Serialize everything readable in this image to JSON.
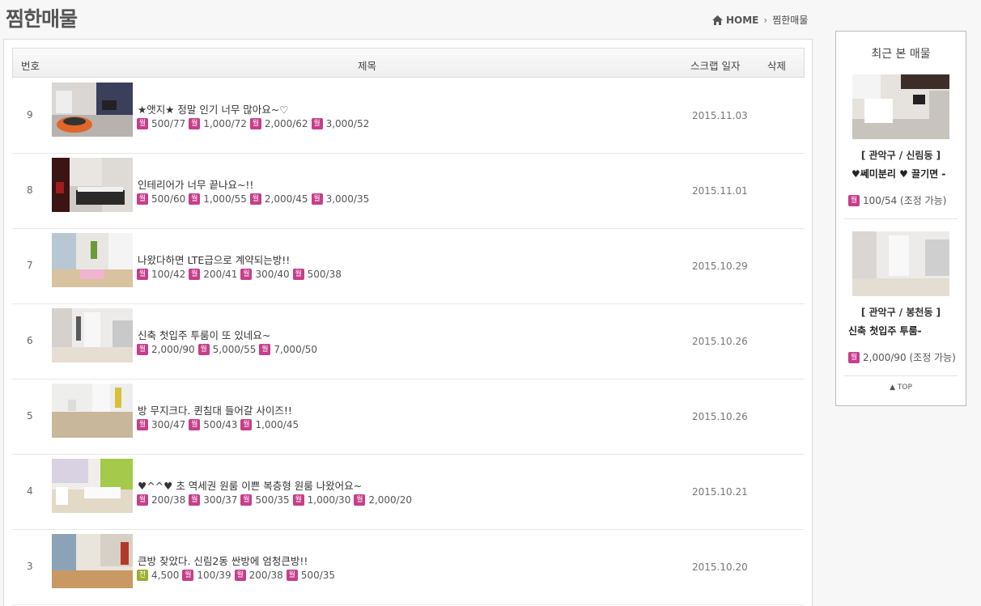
{
  "page": {
    "title": "찜한매물",
    "breadcrumb": {
      "home": "HOME",
      "current": "찜한매물"
    }
  },
  "table": {
    "headers": {
      "num": "번호",
      "title": "제목",
      "date": "스크랩 일자",
      "delete": "삭제"
    },
    "rows": [
      {
        "num": "9",
        "title": "★앳지★ 정말 인기 너무 많아요~♡",
        "date": "2015.11.03",
        "prices": [
          {
            "type": "월",
            "value": "500/77"
          },
          {
            "type": "월",
            "value": "1,000/72"
          },
          {
            "type": "월",
            "value": "2,000/62"
          },
          {
            "type": "월",
            "value": "3,000/52"
          }
        ]
      },
      {
        "num": "8",
        "title": "인테리어가 너무 끝나요~!!",
        "date": "2015.11.01",
        "prices": [
          {
            "type": "월",
            "value": "500/60"
          },
          {
            "type": "월",
            "value": "1,000/55"
          },
          {
            "type": "월",
            "value": "2,000/45"
          },
          {
            "type": "월",
            "value": "3,000/35"
          }
        ]
      },
      {
        "num": "7",
        "title": "나왔다하면 LTE급으로 계약되는방!!",
        "date": "2015.10.29",
        "prices": [
          {
            "type": "월",
            "value": "100/42"
          },
          {
            "type": "월",
            "value": "200/41"
          },
          {
            "type": "월",
            "value": "300/40"
          },
          {
            "type": "월",
            "value": "500/38"
          }
        ]
      },
      {
        "num": "6",
        "title": "신축 첫입주 투룸이 또 있네요~",
        "date": "2015.10.26",
        "prices": [
          {
            "type": "월",
            "value": "2,000/90"
          },
          {
            "type": "월",
            "value": "5,000/55"
          },
          {
            "type": "월",
            "value": "7,000/50"
          }
        ]
      },
      {
        "num": "5",
        "title": "방 무지크다. 퀸침대 들어갈 사이즈!!",
        "date": "2015.10.26",
        "prices": [
          {
            "type": "월",
            "value": "300/47"
          },
          {
            "type": "월",
            "value": "500/43"
          },
          {
            "type": "월",
            "value": "1,000/45"
          }
        ]
      },
      {
        "num": "4",
        "title": "♥^^♥ 초 역세권 원룸 이쁜 복층형 원룸 나왔어요~",
        "date": "2015.10.21",
        "prices": [
          {
            "type": "월",
            "value": "200/38"
          },
          {
            "type": "월",
            "value": "300/37"
          },
          {
            "type": "월",
            "value": "500/35"
          },
          {
            "type": "월",
            "value": "1,000/30"
          },
          {
            "type": "월",
            "value": "2,000/20"
          }
        ]
      },
      {
        "num": "3",
        "title": "큰방 찾았다. 신림2동 싼방에 엄청큰방!!",
        "date": "2015.10.20",
        "prices": [
          {
            "type": "전",
            "value": "4,500"
          },
          {
            "type": "월",
            "value": "100/39"
          },
          {
            "type": "월",
            "value": "200/38"
          },
          {
            "type": "월",
            "value": "500/35"
          }
        ]
      }
    ]
  },
  "recent": {
    "title": "최근 본 매물",
    "cards": [
      {
        "region": "[ 관악구 / 신림동 ]",
        "title": "♥쎄미분리 ♥ 끌기면 -",
        "badge": "월",
        "price": "100/54 (조정 가능)"
      },
      {
        "region": "[ 관악구 / 봉천동 ]",
        "title": "신축 첫입주 투룸-",
        "badge": "월",
        "price": "2,000/90 (조정 가능)"
      }
    ],
    "top_label": "TOP"
  },
  "colors": {
    "monthly_badge": "#c63e8b",
    "jeonse_badge": "#9cae2f"
  }
}
